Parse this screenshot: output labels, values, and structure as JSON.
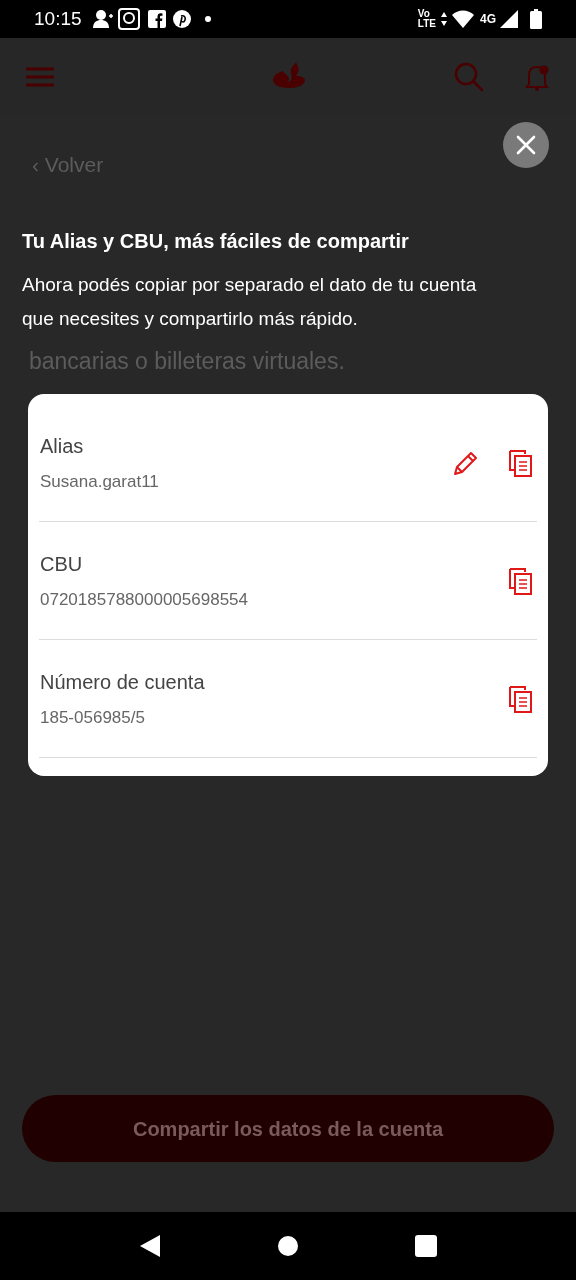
{
  "status_bar": {
    "time": "10:15",
    "volte_top": "Vo",
    "volte_bottom": "LTE",
    "network": "4G"
  },
  "background": {
    "back_link": "‹ Volver",
    "description_tail": "bancarias o billeteras virtuales.",
    "button": "Compartir los datos de la cuenta"
  },
  "overlay": {
    "title": "Tu Alias y CBU, más fáciles de compartir",
    "message": "Ahora podés copiar por separado el dato de tu cuenta que necesites y compartirlo más rápido.",
    "fields": [
      {
        "label": "Alias",
        "value": "Susana.garat11",
        "editable": true
      },
      {
        "label": "CBU",
        "value": "0720185788000005698554",
        "editable": false
      },
      {
        "label": "Número de cuenta",
        "value": "185-056985/5",
        "editable": false
      }
    ]
  }
}
